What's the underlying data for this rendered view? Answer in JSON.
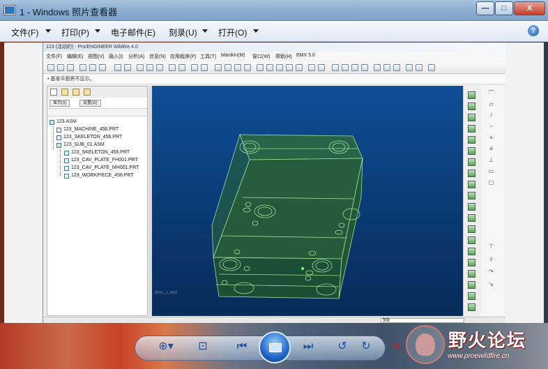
{
  "window": {
    "title": "1 - Windows 照片查看器",
    "buttons": {
      "minimize": "—",
      "maximize": "□",
      "close": "X"
    }
  },
  "menu": {
    "items": [
      {
        "label": "文件(F)",
        "has_arrow": true
      },
      {
        "label": "打印(P)",
        "has_arrow": true
      },
      {
        "label": "电子邮件(E)",
        "has_arrow": false
      },
      {
        "label": "刻录(U)",
        "has_arrow": true
      },
      {
        "label": "打开(O)",
        "has_arrow": true
      }
    ],
    "help": "?"
  },
  "proe": {
    "title": "123 (活动的) - Pro/ENGINEER Wildfire 4.0",
    "menu": [
      "文件(F)",
      "编辑(E)",
      "视图(V)",
      "插入(I)",
      "分析(A)",
      "信息(N)",
      "应用程序(P)",
      "工具(T)",
      "Manikin(M)",
      "窗口(W)",
      "帮助(H)",
      "EMX 5.0"
    ],
    "message": "• 基准平面将不显示。",
    "tree_buttons": {
      "show": "显示(0)",
      "settings": "设置(G)"
    },
    "tree": [
      {
        "label": "123.ASM",
        "level": 0
      },
      {
        "label": "123_MACHINE_456.PRT",
        "level": 1
      },
      {
        "label": "123_SKELETON_456.PRT",
        "level": 1
      },
      {
        "label": "123_SUB_01.ASM",
        "level": 1
      },
      {
        "label": "123_SKELETON_456.PRT",
        "level": 2
      },
      {
        "label": "123_CAV_PLATE_FH001.PRT",
        "level": 2
      },
      {
        "label": "123_CAV_PLATE_MH001.PRT",
        "level": 2
      },
      {
        "label": "123_WORKPIECE_456.PRT",
        "level": 2
      }
    ],
    "viewport_caption": "REVL_1_0081",
    "status_box": "智能"
  },
  "controls": {
    "zoom": "⊕▾",
    "fit": "⊡",
    "prev": "⏮",
    "next": "⏭",
    "rotate_ccw": "↺",
    "rotate_cw": "↻",
    "delete": "✕"
  },
  "watermark": {
    "title": "野火论坛",
    "url": "www.proewildfire.cn"
  },
  "colors": {
    "viewport_top": "#0f4e96",
    "viewport_bottom": "#082b58",
    "model_edges": "#9fe09a",
    "model_fill": "#2c6a3a"
  }
}
